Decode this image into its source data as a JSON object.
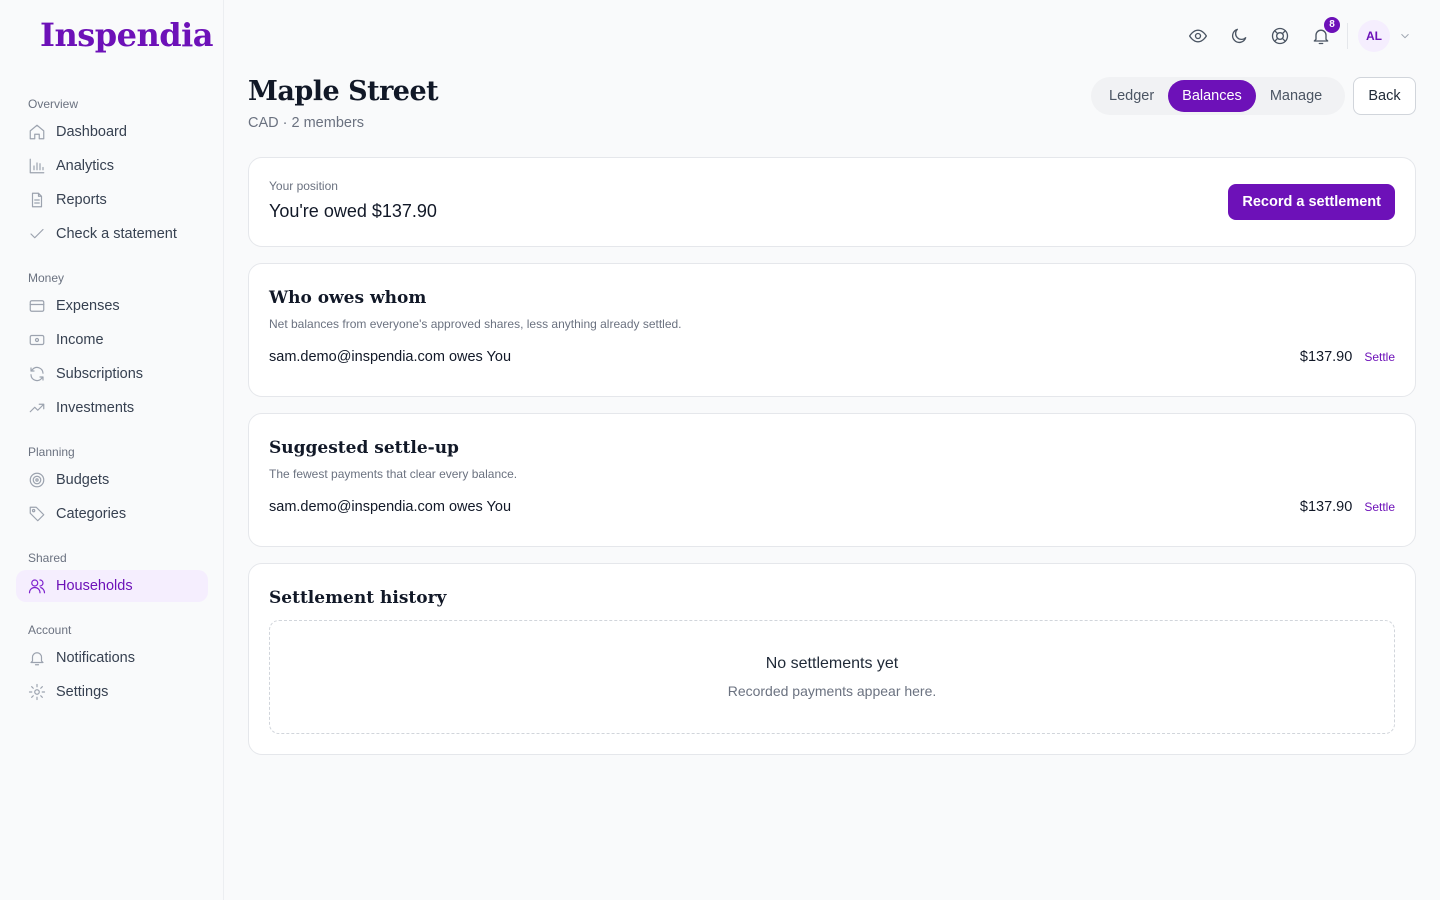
{
  "brand": "Inspendia",
  "sidebar": {
    "sections": [
      {
        "heading": "Overview",
        "items": [
          {
            "label": "Dashboard",
            "icon": "home-icon"
          },
          {
            "label": "Analytics",
            "icon": "bar-chart-icon"
          },
          {
            "label": "Reports",
            "icon": "document-icon"
          },
          {
            "label": "Check a statement",
            "icon": "check-icon"
          }
        ]
      },
      {
        "heading": "Money",
        "items": [
          {
            "label": "Expenses",
            "icon": "credit-card-icon"
          },
          {
            "label": "Income",
            "icon": "banknote-icon"
          },
          {
            "label": "Subscriptions",
            "icon": "refresh-icon"
          },
          {
            "label": "Investments",
            "icon": "trending-up-icon"
          }
        ]
      },
      {
        "heading": "Planning",
        "items": [
          {
            "label": "Budgets",
            "icon": "target-icon"
          },
          {
            "label": "Categories",
            "icon": "tag-icon"
          }
        ]
      },
      {
        "heading": "Shared",
        "items": [
          {
            "label": "Households",
            "icon": "users-icon",
            "active": true
          }
        ]
      },
      {
        "heading": "Account",
        "items": [
          {
            "label": "Notifications",
            "icon": "bell-icon"
          },
          {
            "label": "Settings",
            "icon": "gear-icon"
          }
        ]
      }
    ]
  },
  "topbar": {
    "notification_count": "8",
    "avatar_initials": "AL"
  },
  "page": {
    "title": "Maple Street",
    "subtitle": "CAD · 2 members",
    "tabs": [
      "Ledger",
      "Balances",
      "Manage"
    ],
    "active_tab": "Balances",
    "back_label": "Back"
  },
  "position": {
    "label": "Your position",
    "value": "You're owed $137.90",
    "button": "Record a settlement"
  },
  "who_owes": {
    "title": "Who owes whom",
    "description": "Net balances from everyone's approved shares, less anything already settled.",
    "row": {
      "who": "sam.demo@inspendia.com owes You",
      "amount": "$137.90",
      "action": "Settle"
    }
  },
  "suggested": {
    "title": "Suggested settle-up",
    "description": "The fewest payments that clear every balance.",
    "row": {
      "who": "sam.demo@inspendia.com owes You",
      "amount": "$137.90",
      "action": "Settle"
    }
  },
  "history": {
    "title": "Settlement history",
    "empty_title": "No settlements yet",
    "empty_sub": "Recorded payments appear here."
  },
  "colors": {
    "accent": "#6d11b8",
    "accent_soft": "#f5eefe"
  }
}
